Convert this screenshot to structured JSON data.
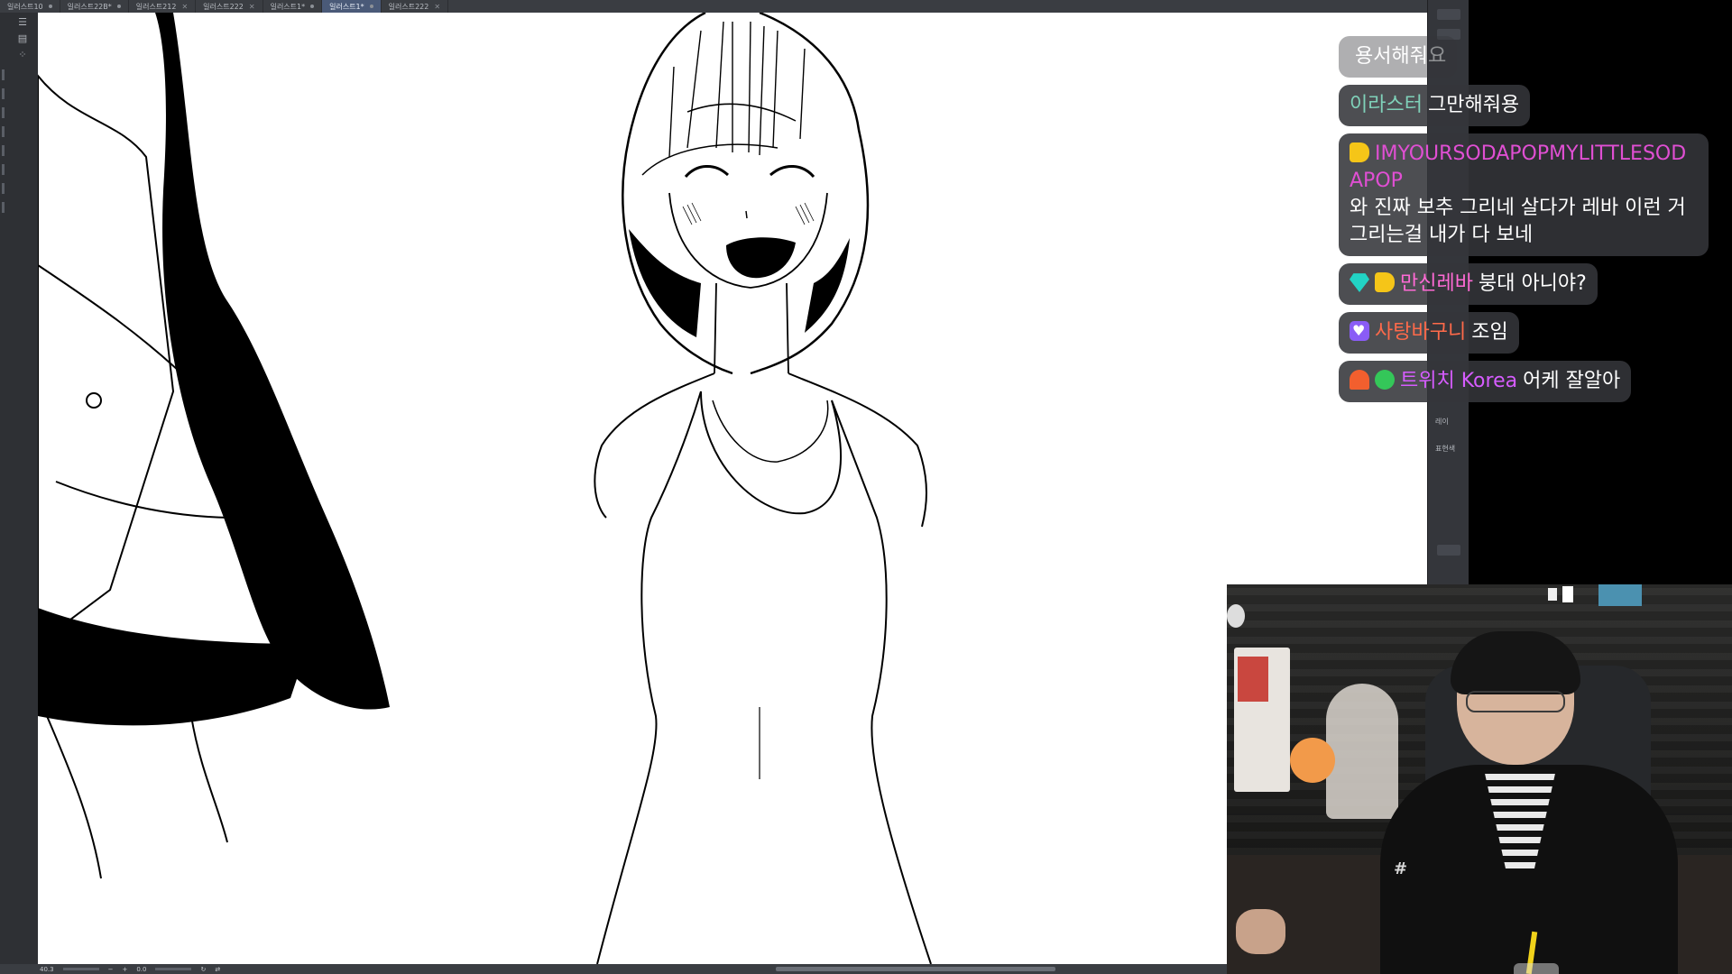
{
  "tabs": [
    {
      "label": "일러스트10",
      "active": false
    },
    {
      "label": "일러스트22B*",
      "active": false
    },
    {
      "label": "일러스트212",
      "active": false
    },
    {
      "label": "일러스트222",
      "active": false
    },
    {
      "label": "일러스트1*",
      "active": false
    },
    {
      "label": "일러스트1*",
      "active": true
    },
    {
      "label": "일러스트222",
      "active": false
    }
  ],
  "status": {
    "zoom": "40.3",
    "angle": "0.0"
  },
  "right_panel": {
    "label1": "레이",
    "label2": "표현색"
  },
  "chat": {
    "messages": [
      {
        "user": "",
        "text": "용서해줘요",
        "user_color": "#7fd1b9",
        "badges": [],
        "faded": true
      },
      {
        "user": "이라스터",
        "text": "그만해줘용",
        "user_color": "#7fd1b9",
        "badges": []
      },
      {
        "user": "IMYOURSODAPOPMYLITTLESODAPOP",
        "text": "와 진짜 보추 그리네 살다가 레바 이런 거 그리는걸 내가 다 보네",
        "user_color": "#e04fd3",
        "badges": [
          "cheese-icon"
        ]
      },
      {
        "user": "만신레바",
        "text": "붕대 아니야?",
        "user_color": "#ff6ad5",
        "badges": [
          "gem-icon",
          "cheese-icon"
        ]
      },
      {
        "user": "사탕바구니",
        "text": "조임",
        "user_color": "#ff6a4a",
        "badges": [
          "heart-icon"
        ]
      },
      {
        "user": "트위치 Korea",
        "text": "어케 잘알아",
        "user_color": "#d65cff",
        "badges": [
          "fire-icon",
          "bug-icon"
        ]
      }
    ]
  },
  "colors": {
    "canvas": "#ffffff",
    "ui_dark": "#3a3d42",
    "chat_bubble": "#34363a"
  }
}
